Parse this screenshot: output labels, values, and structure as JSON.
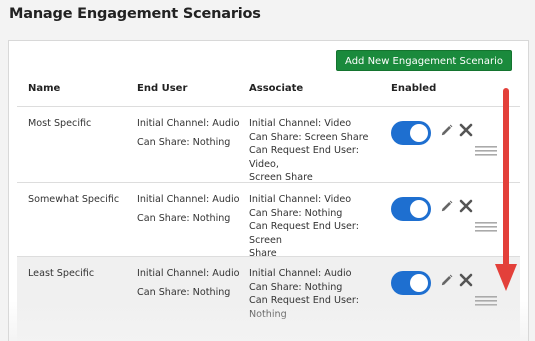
{
  "page": {
    "title": "Manage Engagement Scenarios"
  },
  "toolbar": {
    "add_label": "Add New Engagement Scenario"
  },
  "colors": {
    "accent": "#1a8a3c",
    "toggle_on": "#1e6fd0",
    "arrow": "#e3403a"
  },
  "table": {
    "headers": {
      "name": "Name",
      "end_user": "End User",
      "associate": "Associate",
      "enabled": "Enabled"
    },
    "rows": [
      {
        "name": "Most Specific",
        "end_user": {
          "channel": "Initial Channel: Audio",
          "share": "Can Share: Nothing"
        },
        "associate": [
          "Initial Channel: Video",
          "Can Share: Screen Share",
          "Can Request End User: Video,",
          "Screen Share"
        ],
        "enabled": true
      },
      {
        "name": "Somewhat Specific",
        "end_user": {
          "channel": "Initial Channel: Audio",
          "share": "Can Share: Nothing"
        },
        "associate": [
          "Initial Channel: Video",
          "Can Share: Nothing",
          "Can Request End User: Screen",
          "Share"
        ],
        "enabled": true
      },
      {
        "name": "Least Specific",
        "end_user": {
          "channel": "Initial Channel: Audio",
          "share": "Can Share: Nothing"
        },
        "associate": [
          "Initial Channel: Audio",
          "Can Share: Nothing",
          "Can Request End User:",
          "Nothing"
        ],
        "enabled": true
      }
    ]
  },
  "icons": {
    "edit": "pencil-icon",
    "delete": "close-icon",
    "reorder": "drag-handle-icon",
    "annotation": "arrow-down-icon"
  }
}
